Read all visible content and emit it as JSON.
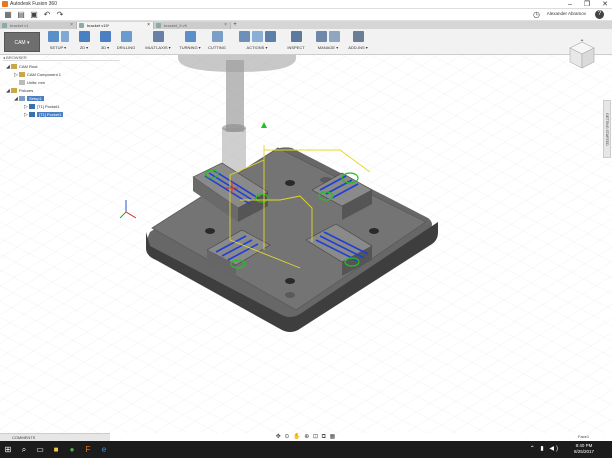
{
  "window": {
    "title": "Autodesk Fusion 360",
    "controls": [
      "–",
      "❐",
      "✕"
    ]
  },
  "appbar": {
    "user": "Alexander Abramov"
  },
  "tabs": [
    {
      "label": "bracket v1",
      "active": false
    },
    {
      "label": "bracket v15*",
      "active": true
    },
    {
      "label": "bracket_5 v5",
      "active": false
    }
  ],
  "toolbar": {
    "workspace": "CAM ▾",
    "groups": [
      {
        "label": "SETUP ▾",
        "color": "#5b8fc9"
      },
      {
        "label": "2D ▾",
        "color": "#4a7fc1"
      },
      {
        "label": "3D ▾",
        "color": "#4a7fc1"
      },
      {
        "label": "DRILLING",
        "color": "#6a9bd0"
      },
      {
        "label": "MULTI-AXIS ▾",
        "color": "#6a7fa8"
      },
      {
        "label": "TURNING ▾",
        "color": "#5b8fc9"
      },
      {
        "label": "CUTTING",
        "color": "#7a9ec6"
      },
      {
        "label": "ACTIONS ▾",
        "color": "#6d8fb8"
      },
      {
        "label": "INSPECT",
        "color": "#5c7a9e"
      },
      {
        "label": "MANAGE ▾",
        "color": "#6f87a8"
      },
      {
        "label": "ADD-INS ▾",
        "color": "#6a7f96"
      }
    ]
  },
  "browser": {
    "header": "BROWSER",
    "rows": [
      {
        "label": "CAM Root",
        "indent": 0,
        "type": "root"
      },
      {
        "label": "CAM Component 1",
        "indent": 1,
        "type": "comp"
      },
      {
        "label": "Units: mm",
        "indent": 1,
        "type": "comp"
      },
      {
        "label": "Fixtures",
        "indent": 0,
        "type": "comp"
      },
      {
        "label": "Setup1",
        "indent": 1,
        "type": "setup",
        "selected": true
      },
      {
        "label": "[T1] Pocket1",
        "indent": 2,
        "type": "op"
      },
      {
        "label": "[T1] Pocket1",
        "indent": 2,
        "type": "op",
        "selected": true
      }
    ]
  },
  "right_panel": {
    "label": "GETTING STARTED"
  },
  "viewcube": {
    "face": "FRONT"
  },
  "statusbar": {
    "comments": "COMMENTS",
    "nav_icons": "✥ ⊙ ✋ ⊕ ⊡ ⧉ ▦",
    "selection": "Face1"
  },
  "taskbar": {
    "time": "8:40 PM",
    "date": "8/25/2017",
    "icons": [
      "windows-icon",
      "search-icon",
      "task-view-icon",
      "file-explorer-icon",
      "chrome-icon",
      "fusion-icon",
      "edge-icon"
    ]
  }
}
